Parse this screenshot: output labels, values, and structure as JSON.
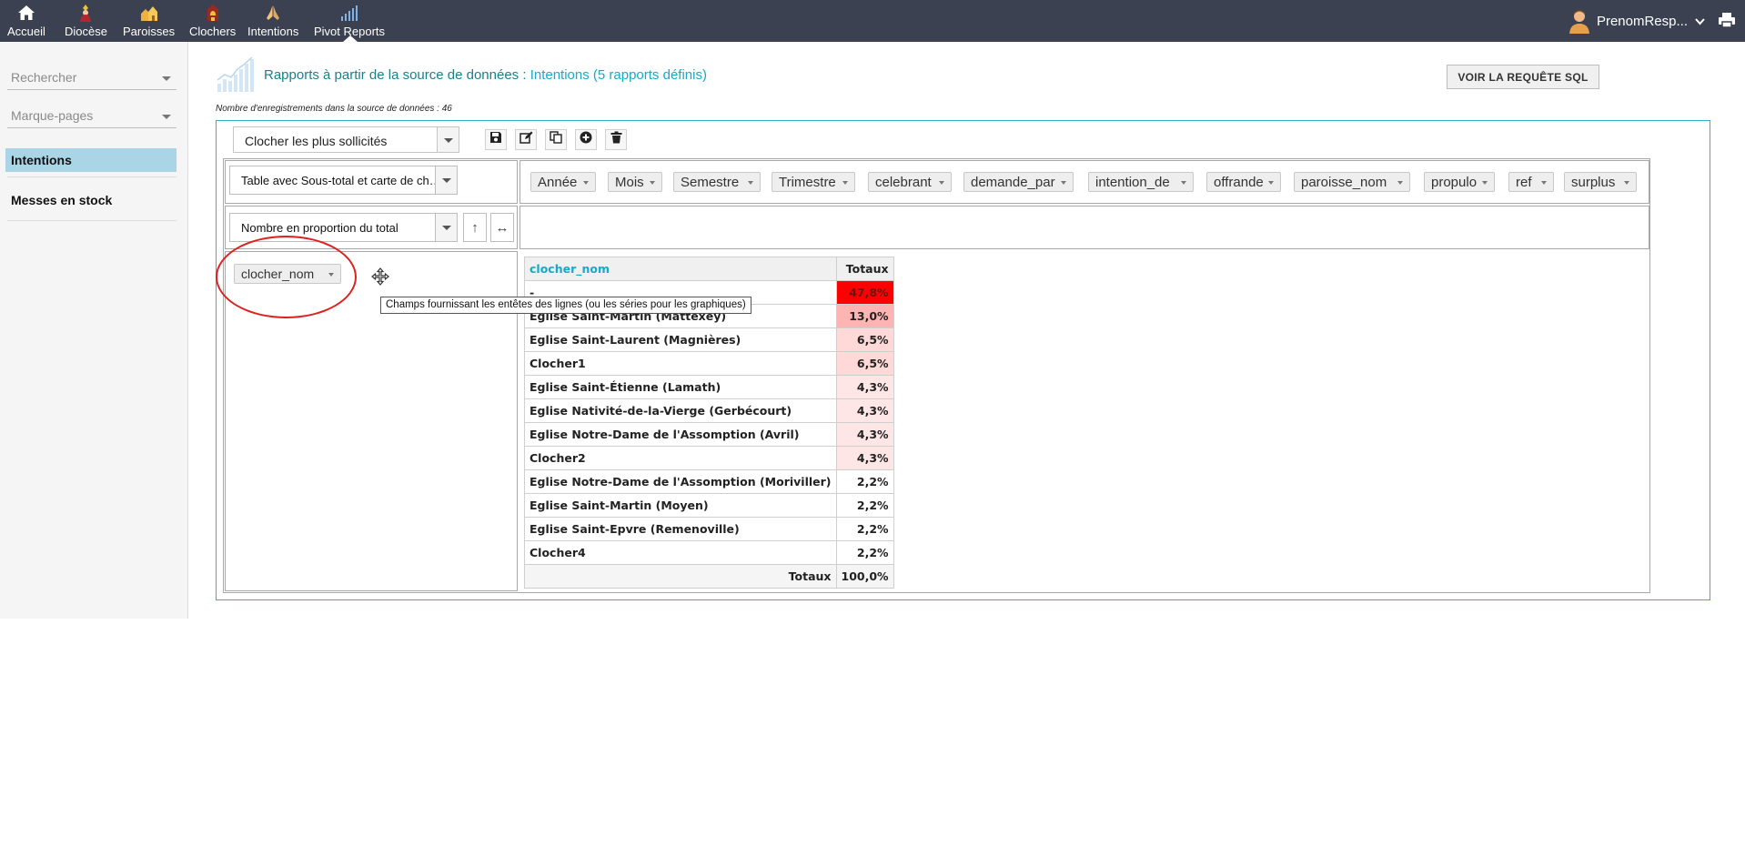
{
  "nav": {
    "items": [
      {
        "label": "Accueil",
        "icon": "home-icon"
      },
      {
        "label": "Diocèse",
        "icon": "bishop-icon"
      },
      {
        "label": "Paroisses",
        "icon": "churches-icon"
      },
      {
        "label": "Clochers",
        "icon": "bell-tower-icon"
      },
      {
        "label": "Intentions",
        "icon": "praying-hands-icon"
      },
      {
        "label": "Pivot Reports",
        "icon": "bar-chart-icon"
      }
    ],
    "active": "Pivot Reports",
    "user_name": "PrenomResp...",
    "bar_color": "#3b4151"
  },
  "sidebar": {
    "search_placeholder": "Rechercher",
    "bookmarks_placeholder": "Marque-pages",
    "items": [
      {
        "label": "Intentions",
        "active": true
      },
      {
        "label": "Messes en stock",
        "active": false
      }
    ]
  },
  "header": {
    "title_prefix": "Rapports à partir de la source de données :",
    "title_source": "Intentions (5 rapports définis)",
    "record_count": "Nombre d'enregistrements dans la source de données : 46",
    "sql_button": "VOIR LA REQUÊTE SQL"
  },
  "pivot": {
    "report_select": "Clocher les plus sollicités",
    "renderer_select": "Table avec Sous-total et carte de chaleur",
    "aggregator_select": "Nombre en proportion du total",
    "sort_row_symbol": "↑",
    "sort_col_symbol": "↔",
    "unused_fields": [
      "Année",
      "Mois",
      "Semestre",
      "Trimestre",
      "celebrant",
      "demande_par",
      "intention_de",
      "offrande",
      "paroisse_nom",
      "propulo",
      "ref",
      "surplus"
    ],
    "row_fields": [
      "clocher_nom"
    ],
    "tooltip": "Champs fournissant les entêtes des lignes (ou les séries pour les graphiques)"
  },
  "results": {
    "row_header": "clocher_nom",
    "col_header": "Totaux",
    "rows": [
      {
        "label": "-",
        "value": "47,8%",
        "heat": 1.0
      },
      {
        "label": "Eglise Saint-Martin (Mattexey)",
        "value": "13,0%",
        "heat": 0.27
      },
      {
        "label": "Eglise Saint-Laurent (Magnières)",
        "value": "6,5%",
        "heat": 0.14
      },
      {
        "label": "Clocher1",
        "value": "6,5%",
        "heat": 0.14
      },
      {
        "label": "Eglise Saint-Étienne (Lamath)",
        "value": "4,3%",
        "heat": 0.09
      },
      {
        "label": "Eglise Nativité-de-la-Vierge (Gerbécourt)",
        "value": "4,3%",
        "heat": 0.09
      },
      {
        "label": "Eglise Notre-Dame de l'Assomption (Avril)",
        "value": "4,3%",
        "heat": 0.09
      },
      {
        "label": "Clocher2",
        "value": "4,3%",
        "heat": 0.09
      },
      {
        "label": "Eglise Notre-Dame de l'Assomption (Moriviller)",
        "value": "2,2%",
        "heat": 0.0
      },
      {
        "label": "Eglise Saint-Martin (Moyen)",
        "value": "2,2%",
        "heat": 0.0
      },
      {
        "label": "Eglise Saint-Epvre (Remenoville)",
        "value": "2,2%",
        "heat": 0.0
      },
      {
        "label": "Clocher4",
        "value": "2,2%",
        "heat": 0.0
      }
    ],
    "total_label": "Totaux",
    "total_value": "100,0%",
    "heat_color": "#ff0000"
  }
}
